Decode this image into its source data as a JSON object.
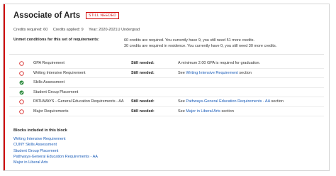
{
  "header": {
    "title": "Associate of Arts",
    "badge": "STILL NEEDED"
  },
  "meta": {
    "credits_required": "Credits required:  60",
    "credits_applied": "Credits applied:  9",
    "year": "Year:  2020-2021U Undergrad"
  },
  "unmet": {
    "label": "Unmet conditions for this set of requirements:",
    "lines": [
      "60 credits are required. You currently have 9, you still need 51 more credits.",
      "30 credits are required in residence. You currently have 0, you still need 30 more credits."
    ]
  },
  "rows": [
    {
      "status": "needed",
      "name": "GPA Requirement",
      "needed": "Still needed:",
      "detail_text": "A minimum 2.00 GPA is required for graduation.",
      "pre": "",
      "link": "",
      "post": ""
    },
    {
      "status": "needed",
      "name": "Writing Intensive Requirement",
      "needed": "Still needed:",
      "detail_text": "",
      "pre": "See ",
      "link": "Writing Intensive Requirement",
      "post": " section"
    },
    {
      "status": "done",
      "name": "Skills Assessment",
      "needed": "",
      "detail_text": "",
      "pre": "",
      "link": "",
      "post": ""
    },
    {
      "status": "done",
      "name": "Student Group Placement",
      "needed": "",
      "detail_text": "",
      "pre": "",
      "link": "",
      "post": ""
    },
    {
      "status": "needed",
      "name": "PATHWAYS - General Education Requirements - AA",
      "needed": "Still needed:",
      "detail_text": "",
      "pre": "See ",
      "link": "Pathways-General Education Requirements - AA",
      "post": " section"
    },
    {
      "status": "needed",
      "name": "Major Requirements",
      "needed": "Still needed:",
      "detail_text": "",
      "pre": "See ",
      "link": "Major in Liberal Arts",
      "post": " section"
    }
  ],
  "blocks": {
    "title": "Blocks included in this block",
    "items": [
      "Writing Intensive Requirement",
      "CUNY Skills Assessment",
      "Student Group Placement",
      "Pathways-General Education Requirements - AA",
      "Major in Liberal Arts"
    ]
  },
  "colors": {
    "accent": "#d10b0b",
    "link": "#1a5cb8",
    "done": "#2e8b3e"
  }
}
